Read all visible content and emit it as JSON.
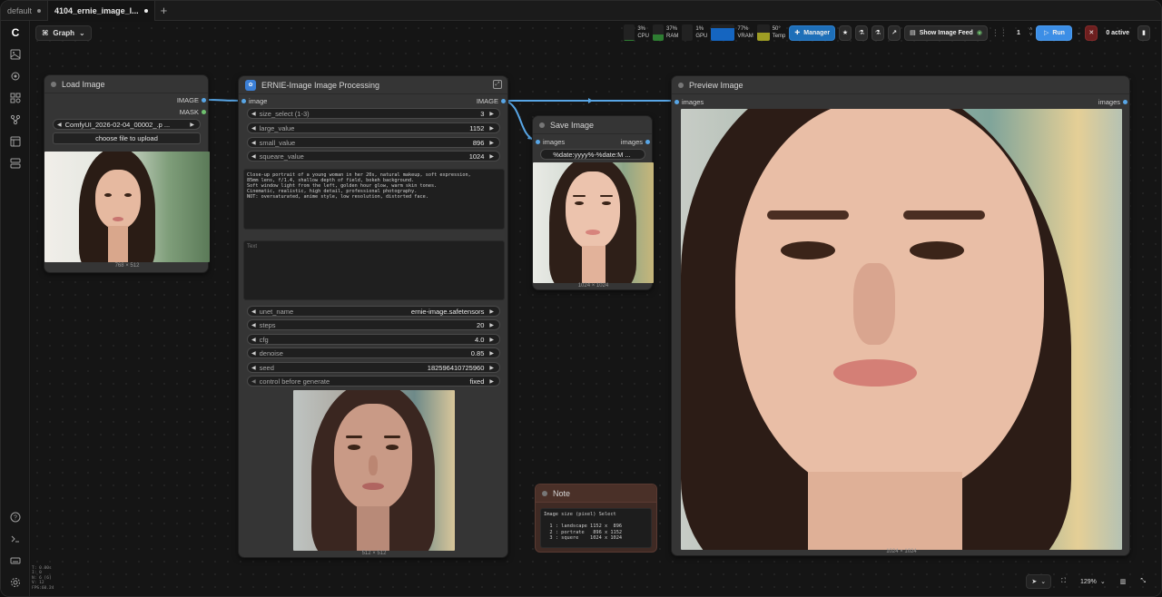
{
  "tabs": [
    {
      "label": "default",
      "active": false
    },
    {
      "label": "4104_ernie_image_l...",
      "active": true
    }
  ],
  "toolbar": {
    "graph_label": "Graph",
    "monitors": [
      {
        "value": "3%",
        "label": "CPU",
        "color": "#2e7d32",
        "level": 0.03
      },
      {
        "value": "37%",
        "label": "RAM",
        "color": "#2e7d32",
        "level": 0.37
      },
      {
        "value": "1%",
        "label": "GPU",
        "color": "#2e7d32",
        "level": 0.01
      },
      {
        "value": "77%",
        "label": "VRAM",
        "color": "#1565c0",
        "level": 0.77
      },
      {
        "value": "50°",
        "label": "Temp",
        "color": "#9e9d24",
        "level": 0.5
      }
    ],
    "manager_label": "Manager",
    "show_feed_label": "Show Image Feed",
    "queue_count": "1",
    "run_label": "Run",
    "active_label": "0 active"
  },
  "load_image": {
    "title": "Load Image",
    "out_image": "IMAGE",
    "out_mask": "MASK",
    "file_value": "ComfyUI_2026-02-04_00002_.p ...",
    "upload_label": "choose file to upload",
    "dims": "768 × 512"
  },
  "processing": {
    "title": "ERNIE-Image Image Processing",
    "in_label": "image",
    "out_label": "IMAGE",
    "widgets_top": [
      {
        "label": "size_select (1-3)",
        "value": "3"
      },
      {
        "label": "large_value",
        "value": "1152"
      },
      {
        "label": "small_value",
        "value": "896"
      },
      {
        "label": "squeare_value",
        "value": "1024"
      }
    ],
    "prompt": "Close-up portrait of a young woman in her 20s, natural makeup, soft expression,\n85mm lens, f/1.4, shallow depth of field, bokeh background.\nSoft window light from the left, golden hour glow, warm skin tones.\nCinematic, realistic, high detail, professional photography.\nNOT: oversaturated, anime style, low resolution, distorted face.",
    "negative_placeholder": "Text",
    "widgets_bottom": [
      {
        "label": "unet_name",
        "value": "ernie-image.safetensors"
      },
      {
        "label": "steps",
        "value": "20"
      },
      {
        "label": "cfg",
        "value": "4.0"
      },
      {
        "label": "denoise",
        "value": "0.85"
      },
      {
        "label": "seed",
        "value": "182596410725960"
      },
      {
        "label": "control before generate",
        "value": "fixed"
      }
    ],
    "dims": "512 × 512"
  },
  "save_image": {
    "title": "Save Image",
    "in_label": "images",
    "out_label": "images",
    "prefix_value": "%date:yyyy%-%date:M ...",
    "dims": "1024 × 1024"
  },
  "preview_image": {
    "title": "Preview Image",
    "in_label": "images",
    "out_label": "images",
    "dims": "1024 × 1024"
  },
  "note": {
    "title": "Note",
    "text": "Image size (pixel) Select\n\n  1 : landscape 1152 x  896\n  2 : portrate   896 x 1152\n  3 : squere    1024 x 1024"
  },
  "bottom": {
    "zoom_label": "129%"
  },
  "stats": "T: 0.00s\nI: 0\nN: 6 [6]\nV: 12\nFPS:60.24",
  "colors": {
    "link": "#58a6e6",
    "accent": "#3c8ee6",
    "node_bg": "#353535",
    "note_bg": "#3f2a24"
  }
}
